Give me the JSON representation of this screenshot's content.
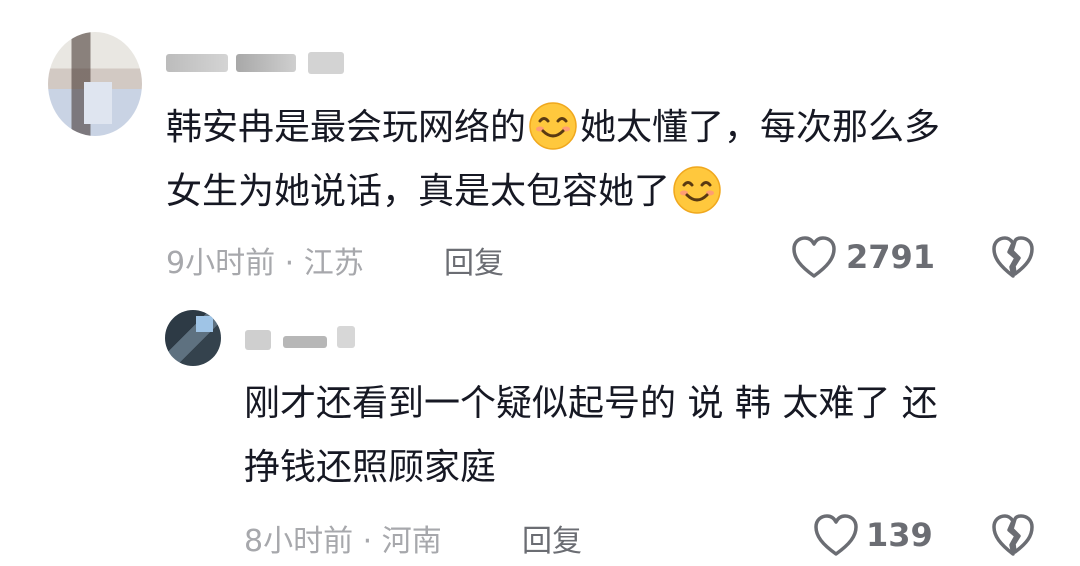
{
  "comment": {
    "text_line1": "韩安冉是最会玩网络的",
    "text_line1_after_emoji": "她太懂了，每次那么多",
    "text_line2": "女生为她说话，真是太包容她了",
    "time_location": "9小时前 · 江苏",
    "reply_label": "回复",
    "like_count": "2791",
    "emoji_icon": "smile-emoji-icon"
  },
  "reply": {
    "text_line1": "刚才还看到一个疑似起号的 说 韩 太难了 还",
    "text_line2": "挣钱还照顾家庭",
    "time_location": "8小时前 · 河南",
    "reply_label": "回复",
    "like_count": "139"
  },
  "colors": {
    "text": "#161823",
    "meta": "#a7a8ac",
    "action": "#6b6d73",
    "emoji_face": "#FFC83D"
  }
}
